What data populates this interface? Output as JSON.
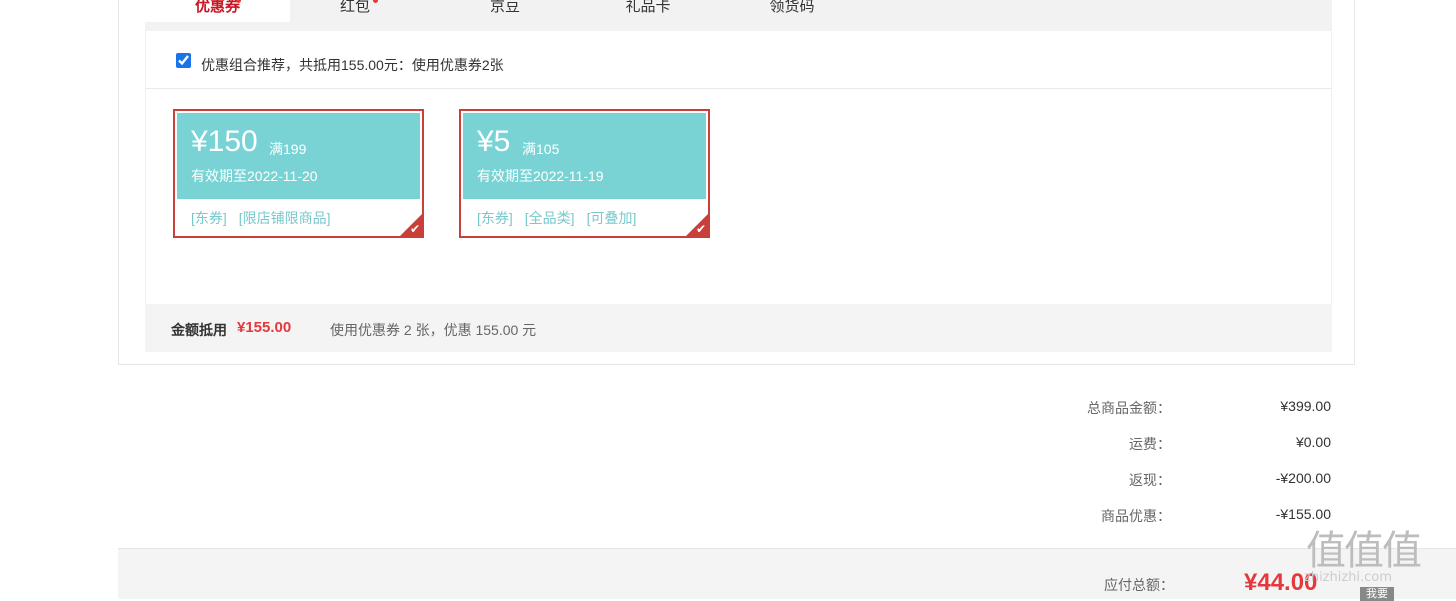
{
  "tabs": [
    {
      "label": "优惠券",
      "active": true,
      "dot": true
    },
    {
      "label": "红包",
      "active": false,
      "dot": true
    },
    {
      "label": "京豆",
      "active": false,
      "dot": false
    },
    {
      "label": "礼品卡",
      "active": false,
      "dot": false
    },
    {
      "label": "领货码",
      "active": false,
      "dot": false
    }
  ],
  "combo": {
    "checked": true,
    "text": "优惠组合推荐，共抵用155.00元：使用优惠券2张"
  },
  "coupons": [
    {
      "amount": "¥150",
      "min": "满199",
      "valid": "有效期至2022-11-20",
      "tags": [
        "[东券]",
        "[限店铺限商品]"
      ],
      "selected": true
    },
    {
      "amount": "¥5",
      "min": "满105",
      "valid": "有效期至2022-11-19",
      "tags": [
        "[东券]",
        "[全品类]",
        "[可叠加]"
      ],
      "selected": true
    }
  ],
  "summary": {
    "label": "金额抵用",
    "amount": "¥155.00",
    "desc": "使用优惠券 2 张，优惠 155.00 元"
  },
  "totals": [
    {
      "label": "总商品金额：",
      "value": "¥399.00"
    },
    {
      "label": "运费：",
      "value": "¥0.00"
    },
    {
      "label": "返现：",
      "value": "-¥200.00"
    },
    {
      "label": "商品优惠：",
      "value": "-¥155.00"
    }
  ],
  "pay": {
    "label": "应付总额：",
    "amount": "¥44.00"
  },
  "watermark": {
    "logo": "值值值",
    "url": "zhizhizhi.com",
    "extra": "我要"
  },
  "colors": {
    "accent": "#e4393c",
    "coupon_bg": "#79d3d5",
    "coupon_border": "#c9403a"
  }
}
